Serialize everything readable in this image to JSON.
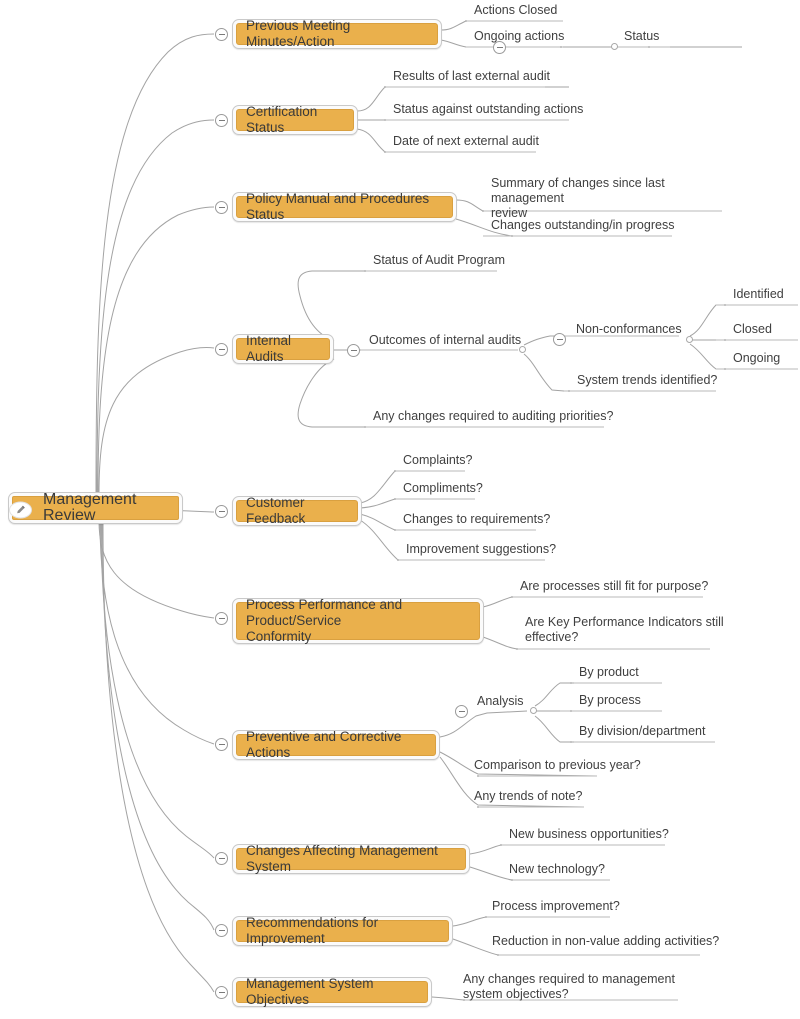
{
  "map": {
    "title": "Management Review",
    "accent_color": "#EAB04C",
    "line_color": "#a0a0a0",
    "text_color": "#3f3f3f",
    "central": {
      "label": "Management Review",
      "icon": "pencil-icon",
      "collapsed": false
    },
    "branches": [
      {
        "label": "Previous Meeting Minutes/Action",
        "toggle": "minus",
        "children": [
          {
            "label": "Actions Closed"
          },
          {
            "label": "Ongoing actions",
            "toggle": "minus",
            "children": [
              {
                "label": "Status"
              }
            ]
          }
        ]
      },
      {
        "label": "Certification Status",
        "toggle": "minus",
        "children": [
          {
            "label": "Results of last external audit"
          },
          {
            "label": "Status against outstanding actions"
          },
          {
            "label": "Date of next external audit"
          }
        ]
      },
      {
        "label": "Policy Manual and Procedures Status",
        "toggle": "minus",
        "children": [
          {
            "label": "Summary of changes since last management\nreview"
          },
          {
            "label": "Changes outstanding/in progress"
          }
        ]
      },
      {
        "label": "Internal Audits",
        "toggle": "minus",
        "children": [
          {
            "label": "Status of Audit Program"
          },
          {
            "label": "Outcomes of internal audits",
            "toggle": "minus",
            "children": [
              {
                "label": "Non-conformances",
                "toggle": "minus",
                "children": [
                  {
                    "label": "Identified"
                  },
                  {
                    "label": "Closed"
                  },
                  {
                    "label": "Ongoing"
                  }
                ]
              },
              {
                "label": "System trends identified?"
              }
            ]
          },
          {
            "label": "Any changes required to auditing priorities?"
          }
        ]
      },
      {
        "label": "Customer Feedback",
        "toggle": "minus",
        "children": [
          {
            "label": "Complaints?"
          },
          {
            "label": "Compliments?"
          },
          {
            "label": "Changes to requirements?"
          },
          {
            "label": "Improvement suggestions?"
          }
        ]
      },
      {
        "label": "Process Performance and Product/Service\nConformity",
        "toggle": "minus",
        "children": [
          {
            "label": "Are processes still fit for purpose?"
          },
          {
            "label": "Are Key Performance Indicators still\neffective?"
          }
        ]
      },
      {
        "label": "Preventive and Corrective Actions",
        "toggle": "minus",
        "children": [
          {
            "label": "Analysis",
            "toggle": "minus",
            "children": [
              {
                "label": "By product"
              },
              {
                "label": "By process"
              },
              {
                "label": "By division/department"
              }
            ]
          },
          {
            "label": "Comparison to previous year?"
          },
          {
            "label": "Any trends of note?"
          }
        ]
      },
      {
        "label": "Changes Affecting Management System",
        "toggle": "minus",
        "children": [
          {
            "label": "New business opportunities?"
          },
          {
            "label": "New technology?"
          }
        ]
      },
      {
        "label": "Recommendations for Improvement",
        "toggle": "minus",
        "children": [
          {
            "label": "Process improvement?"
          },
          {
            "label": "Reduction in non-value adding activities?"
          }
        ]
      },
      {
        "label": "Management System Objectives",
        "toggle": "minus",
        "children": [
          {
            "label": "Any changes required to management\nsystem objectives?"
          }
        ]
      }
    ]
  }
}
